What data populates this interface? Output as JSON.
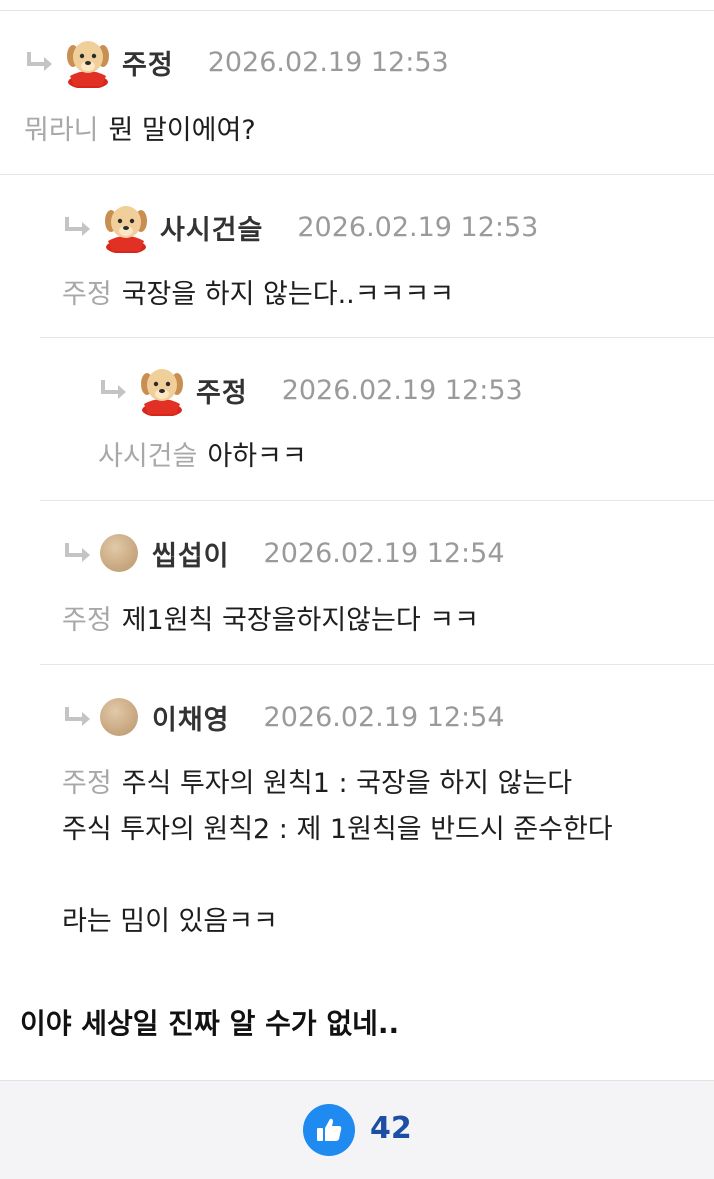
{
  "comments": [
    {
      "nickname": "주정",
      "date": "2026.02.19 12:53",
      "avatar": "puppy-avatar",
      "mention": "뭐라니",
      "text": "뭔 말이에여?"
    },
    {
      "nickname": "사시건슬",
      "date": "2026.02.19 12:53",
      "avatar": "puppy-avatar",
      "mention": "주정",
      "text": "국장을 하지 않는다..ㅋㅋㅋㅋ"
    },
    {
      "nickname": "주정",
      "date": "2026.02.19 12:53",
      "avatar": "puppy-avatar",
      "mention": "사시건슬",
      "text": "아하ㅋㅋ"
    },
    {
      "nickname": "씹섭이",
      "date": "2026.02.19 12:54",
      "avatar": "default-circle-avatar",
      "mention": "주정",
      "text": "제1원칙 국장을하지않는다 ㅋㅋ"
    },
    {
      "nickname": "이채영",
      "date": "2026.02.19 12:54",
      "avatar": "default-circle-avatar",
      "mention": "주정",
      "text": "주식 투자의 원칙1 : 국장을 하지 않는다",
      "line2": "주식 투자의 원칙2 : 제 1원칙을 반드시 준수한다",
      "line3": "라는 밈이 있음ㅋㅋ"
    }
  ],
  "article_text": "이야 세상일 진짜 알 수가 없네..",
  "like": {
    "icon": "thumbs-up-icon",
    "count": "42",
    "color": "#1f8af0"
  }
}
